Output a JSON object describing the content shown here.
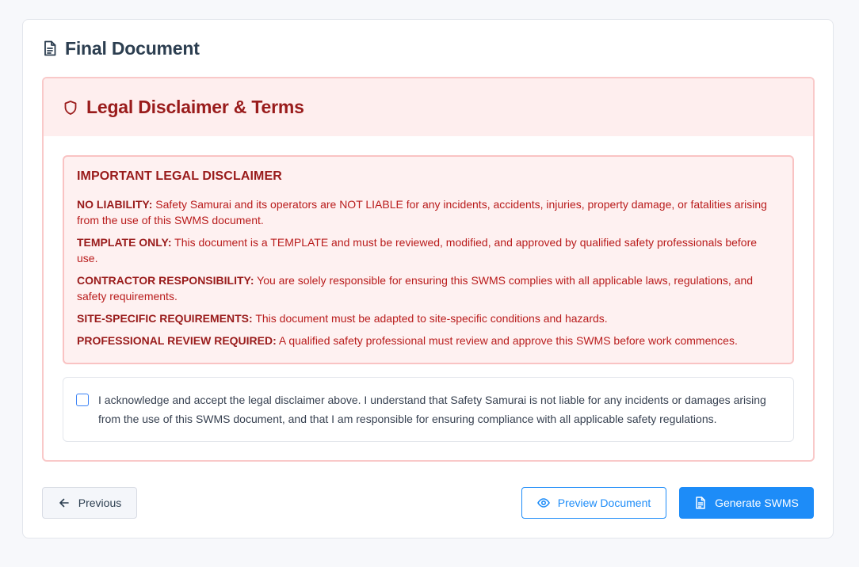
{
  "page": {
    "title": "Final Document"
  },
  "legal": {
    "title": "Legal Disclaimer & Terms",
    "disclaimer_heading": "IMPORTANT LEGAL DISCLAIMER",
    "items": [
      {
        "label": "NO LIABILITY:",
        "text": " Safety Samurai and its operators are NOT LIABLE for any incidents, accidents, injuries, property damage, or fatalities arising from the use of this SWMS document."
      },
      {
        "label": "TEMPLATE ONLY:",
        "text": " This document is a TEMPLATE and must be reviewed, modified, and approved by qualified safety professionals before use."
      },
      {
        "label": "CONTRACTOR RESPONSIBILITY:",
        "text": " You are solely responsible for ensuring this SWMS complies with all applicable laws, regulations, and safety requirements."
      },
      {
        "label": "SITE-SPECIFIC REQUIREMENTS:",
        "text": " This document must be adapted to site-specific conditions and hazards."
      },
      {
        "label": "PROFESSIONAL REVIEW REQUIRED:",
        "text": " A qualified safety professional must review and approve this SWMS before work commences."
      }
    ],
    "acknowledgement": "I acknowledge and accept the legal disclaimer above. I understand that Safety Samurai is not liable for any incidents or damages arising from the use of this SWMS document, and that I am responsible for ensuring compliance with all applicable safety regulations.",
    "acknowledged": false
  },
  "actions": {
    "previous_label": "Previous",
    "preview_label": "Preview Document",
    "generate_label": "Generate SWMS"
  },
  "icons": {
    "header": "document-icon",
    "legal": "shield-icon",
    "previous": "arrow-left-icon",
    "preview": "eye-icon",
    "generate": "document-icon"
  },
  "colors": {
    "accent": "#1d8cf8",
    "danger_text": "#991b1b",
    "danger_bg": "#feeeee"
  }
}
